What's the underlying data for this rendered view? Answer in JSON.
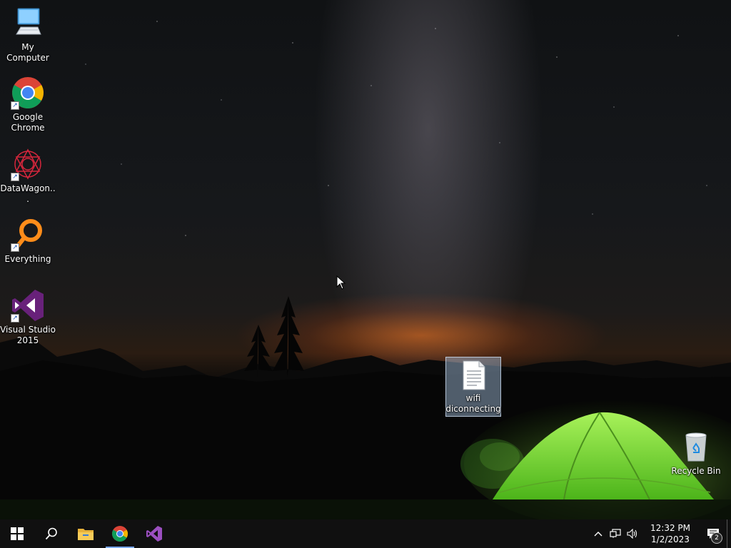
{
  "desktop": {
    "icons": [
      {
        "label": "My Computer",
        "icon": "computer-icon",
        "shortcut": false
      },
      {
        "label": "Google Chrome",
        "icon": "chrome-icon",
        "shortcut": true
      },
      {
        "label": "DataWagon...",
        "icon": "datawagon-icon",
        "shortcut": true
      },
      {
        "label": "Everything",
        "icon": "everything-search-icon",
        "shortcut": true
      },
      {
        "label": "Visual Studio 2015",
        "icon": "visual-studio-icon",
        "shortcut": true
      }
    ],
    "selected_file": {
      "label": "wifi diconnecting",
      "icon": "text-document-icon"
    },
    "recycle_bin": {
      "label": "Recycle Bin",
      "icon": "recycle-bin-icon"
    }
  },
  "taskbar": {
    "pinned": [
      {
        "name": "start",
        "icon": "windows-start-icon"
      },
      {
        "name": "search",
        "icon": "search-icon"
      },
      {
        "name": "file-explorer",
        "icon": "folder-icon"
      },
      {
        "name": "chrome",
        "icon": "chrome-icon",
        "active": true
      },
      {
        "name": "visual-studio",
        "icon": "visual-studio-icon"
      }
    ],
    "tray": {
      "time": "12:32 PM",
      "date": "1/2/2023",
      "notification_count": "2"
    }
  },
  "colors": {
    "taskbar_bg": "#101010",
    "active_indicator": "#7aa8ff",
    "tent_green": "#7de83a",
    "selection": "#aac8e6"
  }
}
